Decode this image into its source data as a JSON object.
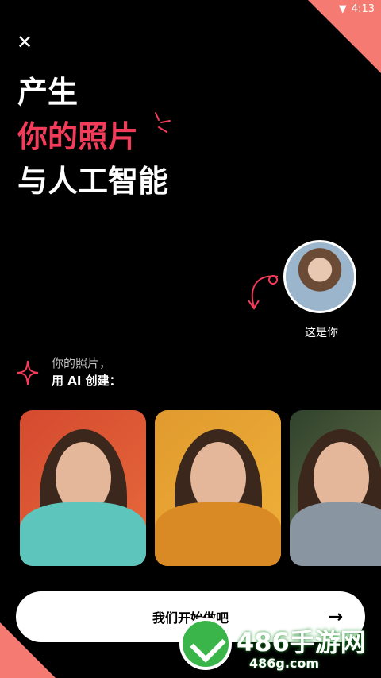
{
  "status_bar": {
    "time": "4:13"
  },
  "headline": {
    "line1": "产生",
    "line2": "你的照片",
    "line3": "与人工智能"
  },
  "avatar": {
    "label": "这是你"
  },
  "prompt": {
    "line1": "你的照片，",
    "line2": "用 AI 创建："
  },
  "cta": {
    "label": "我们开始做吧",
    "arrow": "→"
  },
  "watermark": {
    "title": "486手游网",
    "url": "486g.com"
  },
  "colors": {
    "accent": "#f43b5a",
    "corner": "#f47a72",
    "background": "#000000"
  }
}
